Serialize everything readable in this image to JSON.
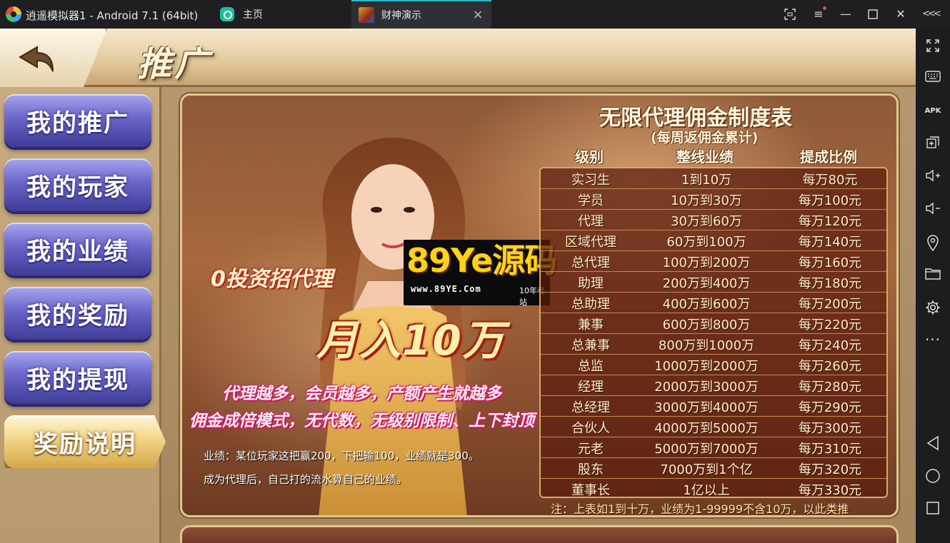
{
  "window": {
    "app_title": "逍遥模拟器1 - Android 7.1 (64bit)",
    "tabs": [
      {
        "label": "主页",
        "active": false
      },
      {
        "label": "财神演示",
        "active": true
      }
    ]
  },
  "game": {
    "page_title": "推广",
    "menu": [
      {
        "label": "我的推广",
        "active": false
      },
      {
        "label": "我的玩家",
        "active": false
      },
      {
        "label": "我的业绩",
        "active": false
      },
      {
        "label": "我的奖励",
        "active": false
      },
      {
        "label": "我的提现",
        "active": false
      },
      {
        "label": "奖励说明",
        "active": true
      }
    ],
    "promo": {
      "tagline": "0投资招代理",
      "income": "月入10万",
      "line_1": "代理越多，会员越多，产额产生就越多",
      "line_2": "佣金成倍模式，无代数，无级别限制、上下封顶",
      "note_1": "业绩：某位玩家这把赢200，下把输100，业绩就是300。",
      "note_2": "成为代理后，自己打的流水算自己的业绩。"
    },
    "watermark": {
      "logo": "89Ye源码",
      "url": "www.89YE.Com",
      "tag": "10年老站"
    },
    "table": {
      "title": "无限代理佣金制度表",
      "subtitle": "(每周返佣金累计)",
      "headers": [
        "级别",
        "整线业绩",
        "提成比例"
      ],
      "rows": [
        [
          "实习生",
          "1到10万",
          "每万80元"
        ],
        [
          "学员",
          "10万到30万",
          "每万100元"
        ],
        [
          "代理",
          "30万到60万",
          "每万120元"
        ],
        [
          "区域代理",
          "60万到100万",
          "每万140元"
        ],
        [
          "总代理",
          "100万到200万",
          "每万160元"
        ],
        [
          "助理",
          "200万到400万",
          "每万180元"
        ],
        [
          "总助理",
          "400万到600万",
          "每万200元"
        ],
        [
          "兼事",
          "600万到800万",
          "每万220元"
        ],
        [
          "总兼事",
          "800万到1000万",
          "每万240元"
        ],
        [
          "总监",
          "1000万到2000万",
          "每万260元"
        ],
        [
          "经理",
          "2000万到3000万",
          "每万280元"
        ],
        [
          "总经理",
          "3000万到4000万",
          "每万290元"
        ],
        [
          "合伙人",
          "4000万到5000万",
          "每万300元"
        ],
        [
          "元老",
          "5000万到7000万",
          "每万310元"
        ],
        [
          "股东",
          "7000万到1个亿",
          "每万320元"
        ],
        [
          "董事长",
          "1亿以上",
          "每万330元"
        ]
      ],
      "footnote": "注：上表如1到十万，业绩为1-99999不含10万，以此类推"
    }
  },
  "icons": {
    "titlebar": [
      "app-logo-icon",
      "home-tab-icon",
      "game-tab-icon",
      "close-tab-icon",
      "screenshot-icon",
      "menu-icon",
      "minimize-icon",
      "maximize-icon",
      "close-icon",
      "collapse-icon"
    ],
    "tools": [
      "fullscreen-icon",
      "keyboard-icon",
      "apk-install-icon",
      "multi-window-icon",
      "volume-up-icon",
      "volume-down-icon",
      "location-icon",
      "folder-icon",
      "settings-icon",
      "more-icon",
      "nav-back-icon",
      "nav-home-icon",
      "nav-recent-icon"
    ]
  },
  "colors": {
    "accent_tab": "#2bb9c5",
    "menu_purple": "#6b66c9",
    "menu_gold": "#d4a84a",
    "menu_dot": "#ff3b58"
  }
}
